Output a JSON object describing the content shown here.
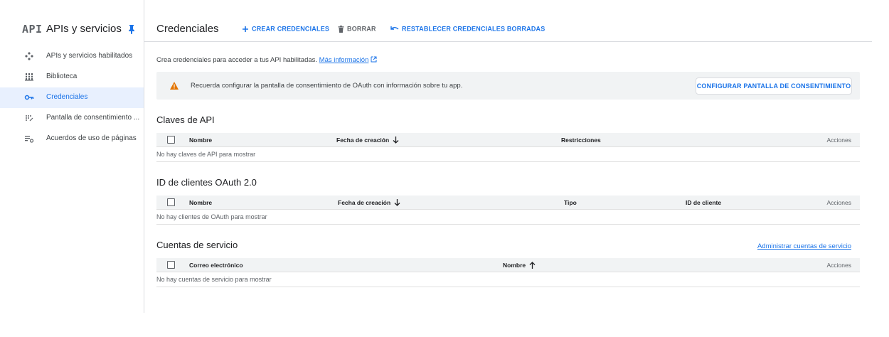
{
  "sidebar": {
    "logo": "API",
    "title": "APIs y servicios",
    "items": [
      {
        "label": "APIs y servicios habilitados",
        "icon": "apis-diamond-icon"
      },
      {
        "label": "Biblioteca",
        "icon": "library-icon"
      },
      {
        "label": "Credenciales",
        "icon": "key-icon",
        "active": true
      },
      {
        "label": "Pantalla de consentimiento ...",
        "icon": "consent-dots-icon"
      },
      {
        "label": "Acuerdos de uso de páginas",
        "icon": "settings-list-icon"
      }
    ]
  },
  "topbar": {
    "title": "Credenciales",
    "create_label": "CREAR CREDENCIALES",
    "delete_label": "BORRAR",
    "restore_label": "RESTABLECER CREDENCIALES BORRADAS"
  },
  "intro": {
    "text": "Crea credenciales para acceder a tus API habilitadas.",
    "link": "Más información"
  },
  "banner": {
    "text": "Recuerda configurar la pantalla de consentimiento de OAuth con información sobre tu app.",
    "button": "CONFIGURAR PANTALLA DE CONSENTIMIENTO"
  },
  "api_keys": {
    "title": "Claves de API",
    "columns": [
      "Nombre",
      "Fecha de creación",
      "Restricciones",
      "Acciones"
    ],
    "empty": "No hay claves de API para mostrar"
  },
  "oauth": {
    "title": "ID de clientes OAuth 2.0",
    "columns": [
      "Nombre",
      "Fecha de creación",
      "Tipo",
      "ID de cliente",
      "Acciones"
    ],
    "empty": "No hay clientes de OAuth para mostrar"
  },
  "service_accounts": {
    "title": "Cuentas de servicio",
    "manage_link": "Administrar cuentas de servicio",
    "columns": [
      "Correo electrónico",
      "Nombre",
      "Acciones"
    ],
    "empty": "No hay cuentas de servicio para mostrar"
  },
  "colors": {
    "accent": "#1a73e8",
    "warning": "#e37400",
    "active_bg": "#e8f0fe",
    "header_bg": "#f1f3f4"
  }
}
